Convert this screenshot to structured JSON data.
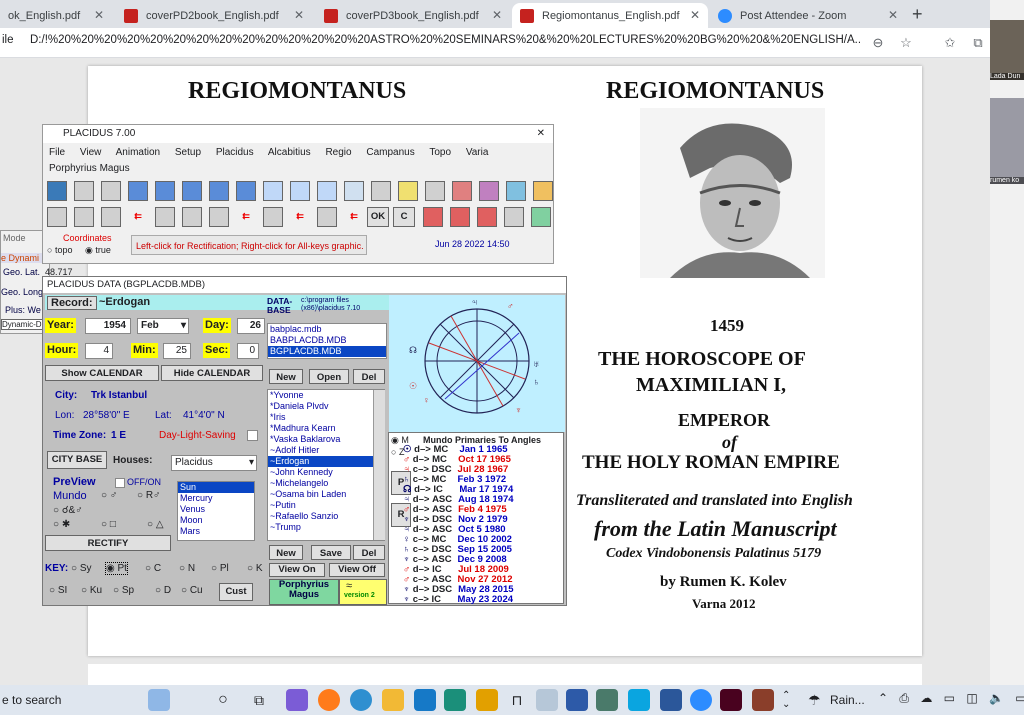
{
  "browser": {
    "tabs": [
      {
        "label": "ok_English.pdf",
        "type": "pdf"
      },
      {
        "label": "coverPD2book_English.pdf",
        "type": "pdf"
      },
      {
        "label": "coverPD3book_English.pdf",
        "type": "pdf"
      },
      {
        "label": "Regiomontanus_English.pdf",
        "type": "pdf",
        "active": true
      },
      {
        "label": "Post Attendee - Zoom",
        "type": "zoom"
      }
    ],
    "new_tab": "+",
    "address_prefix": "ile",
    "address": "D:/!%20%20%20%20%20%20%20%20%20%20%20%20%20%20ASTRO%20%20SEMINARS%20&%20%20LECTURES%20%20BG%20%20&%20ENGLISH/A..."
  },
  "pdf": {
    "left_title": "REGIOMONTANUS",
    "right_title": "REGIOMONTANUS",
    "year": "1459",
    "line1": "THE HOROSCOPE  OF",
    "line2": "MAXIMILIAN I,",
    "line3": "EMPEROR",
    "line4": "of",
    "line5": "THE HOLY ROMAN  EMPIRE",
    "line6": "Transliterated and translated into English",
    "line7": "from the Latin Manuscript",
    "line8": "Codex Vindobonensis Palatinus 5179",
    "line9": "by  Rumen K. Kolev",
    "line10": "Varna  2012",
    "left_varna": "Varna  2012"
  },
  "placidus": {
    "title": "PLACIDUS  7.00",
    "menu": [
      "File",
      "View",
      "Animation",
      "Setup",
      "Placidus",
      "Alcabitius",
      "Regio",
      "Campanus",
      "Topo",
      "Varia"
    ],
    "menu2": "Porphyrius Magus",
    "ok": "OK",
    "c": "C",
    "coordinates_label": "Coordinates",
    "topo": "topo",
    "true": "true",
    "hint": "Left-click for Rectification; Right-click for All-keys graphic.",
    "datetime": "Jun 28 2022 14:50"
  },
  "left_panel": {
    "mode": "Mode",
    "dyn": "e Dynami",
    "geolat": "Geo. Lat.",
    "geolat_val": "48.717",
    "geolong": "Geo. Long",
    "plus": "Plus: We",
    "dynamic": "Dynamic-D"
  },
  "data": {
    "title": "PLACIDUS DATA (BGPLACDB.MDB)",
    "record_label": "Record:",
    "record": "~Erdogan",
    "year_label": "Year:",
    "year": "1954",
    "month": "Feb",
    "day_label": "Day:",
    "day": "26",
    "hour_label": "Hour:",
    "hour": "4",
    "min_label": "Min:",
    "min": "25",
    "sec_label": "Sec:",
    "sec": "0",
    "show_cal": "Show CALENDAR",
    "hide_cal": "Hide CALENDAR",
    "city_label": "City:",
    "city": "Trk Istanbul",
    "lon_label": "Lon:",
    "lon": "28°58'0\" E",
    "lat_label": "Lat:",
    "lat": "41°4'0\" N",
    "tz_label": "Time Zone:",
    "tz": "1 E",
    "dls": "Day-Light-Saving",
    "city_base": "CITY BASE",
    "houses_label": "Houses:",
    "houses": "Placidus",
    "preview": "PreView",
    "offon": "OFF/ON",
    "mundo": "Mundo",
    "rectify": "RECTIFY",
    "planets": [
      "Sun",
      "Mercury",
      "Venus",
      "Moon",
      "Mars"
    ],
    "key_label": "KEY:",
    "keys": [
      "Sy",
      "Pt",
      "C",
      "N",
      "Pl",
      "K",
      "SI",
      "Ku",
      "Sp",
      "D",
      "Cu"
    ],
    "cust": "Cust",
    "database_label": "DATA-\nBASE",
    "db_path": "c:\\program files (x86)\\placidus 7.10",
    "dbs": [
      "babplac.mdb",
      "BABPLACDB.MDB",
      "BGPLACDB.MDB"
    ],
    "new": "New",
    "open": "Open",
    "del": "Del",
    "names": [
      "*Yvonne",
      "*Daniela Plvdv",
      "*Iris",
      "*Madhura Kearn",
      "*Vaska Baklarova",
      "~Adolf Hitler",
      "~Erdogan",
      "~John Kennedy",
      "~Michelangelo",
      "~Osama bin Laden",
      "~Putin",
      "~Rafaello Sanzio",
      "~Trump"
    ],
    "new2": "New",
    "save": "Save",
    "del2": "Del",
    "view_on": "View On",
    "view_off": "View Off",
    "porphyrius": "Porphyrius\nMagus",
    "version": "version 2",
    "varna": "Varna  2012"
  },
  "primaries": {
    "m": "M",
    "z": "Z",
    "header": "Mundo Primaries To Angles",
    "p": "P",
    "r": "R",
    "rows": [
      {
        "a": "d",
        "b": "MC",
        "date": "Jan 1  1965",
        "c": "blue"
      },
      {
        "a": "d",
        "b": "MC",
        "date": "Oct 17  1965",
        "c": "red"
      },
      {
        "a": "c",
        "b": "DSC",
        "date": "Jul 28  1967",
        "c": "red"
      },
      {
        "a": "c",
        "b": "MC",
        "date": "Feb 3  1972",
        "c": "blue"
      },
      {
        "a": "d",
        "b": "IC",
        "date": "Mar 17  1974",
        "c": "blue"
      },
      {
        "a": "d",
        "b": "ASC",
        "date": "Aug 18  1974",
        "c": "blue"
      },
      {
        "a": "d",
        "b": "ASC",
        "date": "Feb 4  1975",
        "c": "red"
      },
      {
        "a": "d",
        "b": "DSC",
        "date": "Nov 2  1979",
        "c": "blue"
      },
      {
        "a": "d",
        "b": "ASC",
        "date": "Oct 5  1980",
        "c": "blue"
      },
      {
        "a": "c",
        "b": "MC",
        "date": "Dec 10  2002",
        "c": "blue"
      },
      {
        "a": "c",
        "b": "DSC",
        "date": "Sep 15  2005",
        "c": "blue"
      },
      {
        "a": "c",
        "b": "ASC",
        "date": "Dec 9  2008",
        "c": "blue"
      },
      {
        "a": "d",
        "b": "IC",
        "date": "Jul 18  2009",
        "c": "red"
      },
      {
        "a": "c",
        "b": "ASC",
        "date": "Nov 27  2012",
        "c": "red"
      },
      {
        "a": "d",
        "b": "DSC",
        "date": "May 28  2015",
        "c": "blue"
      },
      {
        "a": "c",
        "b": "IC",
        "date": "May 23  2024",
        "c": "blue"
      }
    ]
  },
  "zoom_side": {
    "name1": "Lada Dun",
    "name2": "rumen ko"
  },
  "taskbar": {
    "search": "e to search",
    "weather": "Rain..."
  }
}
